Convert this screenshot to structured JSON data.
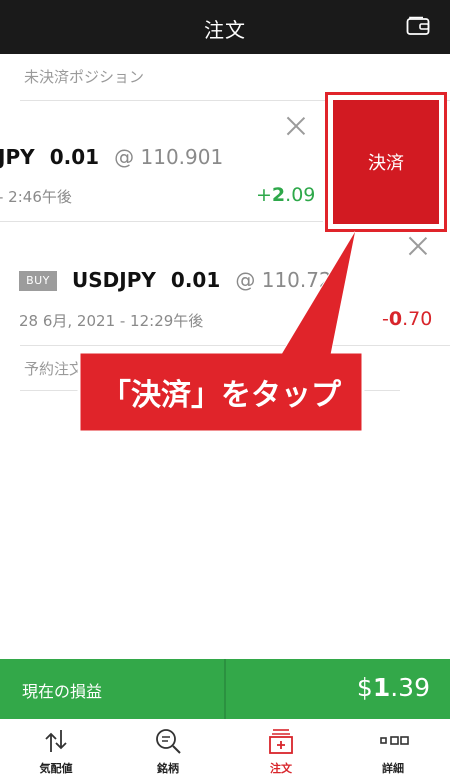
{
  "header": {
    "title": "注文",
    "wallet_icon": "wallet-icon"
  },
  "open_positions": {
    "section_label": "未決済ポジション",
    "rows": [
      {
        "symbol": "JPY",
        "quantity": "0.01",
        "price": "@ 110.901",
        "datetime": "- 2:46午後",
        "pnl_sign": "+",
        "pnl_int": "2",
        "pnl_dec": ".09"
      },
      {
        "side": "BUY",
        "symbol": "USDJPY",
        "quantity": "0.01",
        "price": "@ 110.724",
        "datetime": "28 6月, 2021 - 12:29午後",
        "pnl_sign": "-",
        "pnl_int": "0",
        "pnl_dec": ".70"
      }
    ],
    "settle_button_label": "決済"
  },
  "pending_orders": {
    "section_label": "予約注文"
  },
  "callout": {
    "text": "「決済」をタップ"
  },
  "pl_bar": {
    "label": "現在の損益",
    "value_prefix": "$",
    "value_int": "1",
    "value_dec": ".39"
  },
  "tabs": [
    {
      "label": "気配値",
      "icon": "quotes-icon"
    },
    {
      "label": "銘柄",
      "icon": "search-icon"
    },
    {
      "label": "注文",
      "icon": "order-icon",
      "active": true
    },
    {
      "label": "詳細",
      "icon": "details-icon"
    }
  ],
  "colors": {
    "accent_red": "#d21a22",
    "profit_green": "#2ea84a",
    "loss_red": "#d8252b",
    "bar_green": "#33a849",
    "header_dark": "#1a1a1a"
  }
}
